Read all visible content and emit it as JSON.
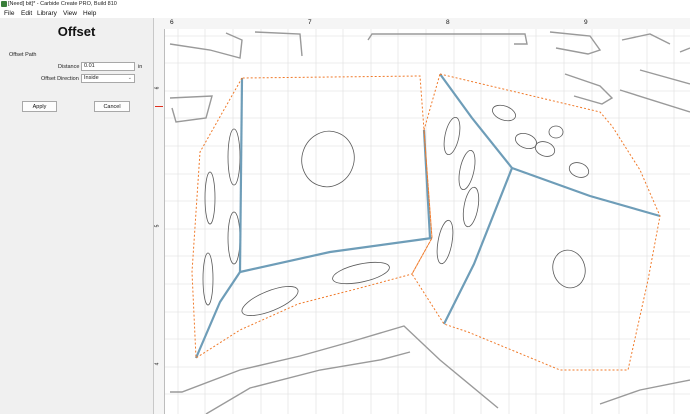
{
  "window": {
    "title": "[Need] bit]* - Carbide Create PRO, Build 810"
  },
  "menu": {
    "items": [
      "File",
      "Edit",
      "Library",
      "View",
      "Help"
    ]
  },
  "panel": {
    "title": "Offset",
    "section_label": "Offset Path",
    "distance_label": "Distance",
    "distance_value": "0.01",
    "distance_unit": "in",
    "direction_label": "Offset Direction",
    "direction_value": "Inside",
    "apply_label": "Apply",
    "cancel_label": "Cancel"
  },
  "rulers": {
    "top_labels": [
      "6",
      "7",
      "8",
      "9"
    ],
    "left_labels": [
      "6",
      "5",
      "4"
    ]
  },
  "colors": {
    "offset_path": "#f07a2a",
    "selected_path": "#4f8fb0",
    "grid": "#dedede"
  }
}
